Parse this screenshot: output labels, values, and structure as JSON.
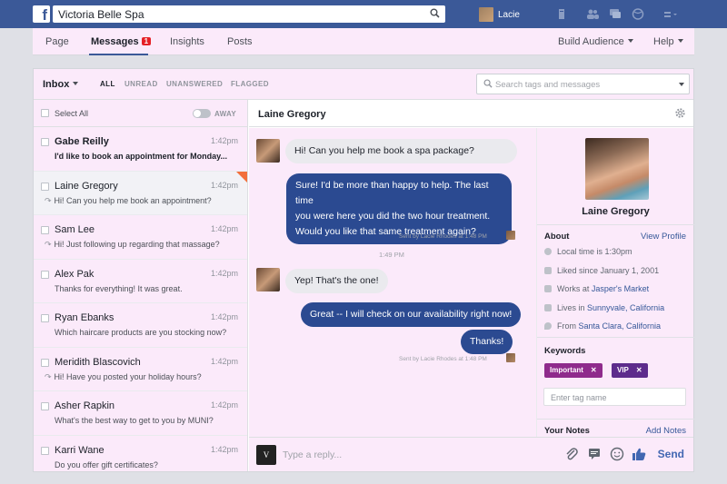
{
  "topbar": {
    "logo": "f",
    "search_value": "Victoria Belle Spa",
    "user_name": "Lacie",
    "icons": [
      "search-icon",
      "page-icon",
      "friends-icon",
      "messages-icon",
      "globe-icon",
      "settings-icon"
    ]
  },
  "tabs": {
    "page": "Page",
    "messages": "Messages",
    "messages_badge": "1",
    "insights": "Insights",
    "posts": "Posts",
    "build_audience": "Build Audience",
    "help": "Help"
  },
  "filters": {
    "inbox": "Inbox",
    "all": "ALL",
    "unread": "UNREAD",
    "unanswered": "UNANSWERED",
    "flagged": "FLAGGED",
    "search_placeholder": "Search tags and messages"
  },
  "list": {
    "select_all": "Select All",
    "away": "AWAY",
    "conversations": [
      {
        "name": "Gabe Reilly",
        "time": "1:42pm",
        "snippet": "I'd like to book an appointment for Monday...",
        "unread": true,
        "replied": false
      },
      {
        "name": "Laine Gregory",
        "time": "1:42pm",
        "snippet": "Hi! Can you help me book an appointment?",
        "unread": false,
        "replied": true
      },
      {
        "name": "Sam Lee",
        "time": "1:42pm",
        "snippet": "Hi! Just following up regarding that massage?",
        "unread": false,
        "replied": true
      },
      {
        "name": "Alex Pak",
        "time": "1:42pm",
        "snippet": "Thanks for everything!  It was great.",
        "unread": false,
        "replied": false
      },
      {
        "name": "Ryan Ebanks",
        "time": "1:42pm",
        "snippet": "Which haircare products are you stocking now?",
        "unread": false,
        "replied": false
      },
      {
        "name": "Meridith Blascovich",
        "time": "1:42pm",
        "snippet": "Hi! Have you posted your holiday hours?",
        "unread": false,
        "replied": true
      },
      {
        "name": "Asher Rapkin",
        "time": "1:42pm",
        "snippet": "What's the best way to get to you by MUNI?",
        "unread": false,
        "replied": false
      },
      {
        "name": "Karri Wane",
        "time": "1:42pm",
        "snippet": "Do you offer gift certificates?",
        "unread": false,
        "replied": false
      }
    ]
  },
  "conversation": {
    "title": "Laine Gregory",
    "msg1": "Hi! Can you help me book a spa package?",
    "msg2_l1": "Sure! I'd be more than happy to help. The last time",
    "msg2_l2": "you were here you did the two hour treatment.",
    "msg2_l3": "Would you like that same treatment again?",
    "sent_by": "Sent by Lacie Rhodes at 1:48 PM",
    "timestamp": "1:49 PM",
    "msg3": "Yep! That's the one!",
    "msg4": "Great -- I will check on our availability right now!",
    "msg5": "Thanks!",
    "reply_placeholder": "Type a reply...",
    "send": "Send",
    "composer_avatar": "V"
  },
  "profile": {
    "name": "Laine Gregory",
    "about": "About",
    "view_profile": "View Profile",
    "local_time": "Local time is 1:30pm",
    "liked_since": "Liked since January 1, 2001",
    "works_prefix": "Works at ",
    "works_link": "Jasper's Market",
    "lives_prefix": "Lives in ",
    "lives_link": "Sunnyvale, California",
    "from_prefix": "From ",
    "from_link": "Santa Clara, California",
    "keywords": "Keywords",
    "tag1": "Important",
    "tag2": "VIP",
    "tag_remove": "✕",
    "tag_placeholder": "Enter tag name",
    "your_notes": "Your Notes",
    "add_notes": "Add Notes"
  },
  "colors": {
    "facebook_blue": "#3b5998",
    "outgoing_bubble": "#2b4a91",
    "important_tag": "#8f2b8c",
    "vip_tag": "#5d2c8c",
    "flag": "#f26f3b"
  }
}
